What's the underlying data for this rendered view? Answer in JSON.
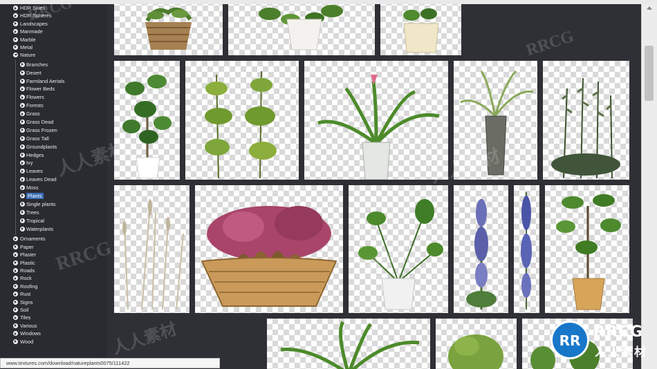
{
  "sidebar": {
    "categories_top": [
      "HDR Skies",
      "HDR Spheres",
      "Landscapes",
      "Manmade",
      "Marble",
      "Metal",
      "Nature"
    ],
    "nature_subcategories": [
      "Branches",
      "Desert",
      "Farmland Aerials",
      "Flower Beds",
      "Flowers",
      "Forests",
      "Grass",
      "Grass Dead",
      "Grass Frozen",
      "Grass Tall",
      "Groundplants",
      "Hedges",
      "Ivy",
      "Leaves",
      "Leaves Dead",
      "Moss",
      "Plants",
      "Single plants",
      "Trees",
      "Tropical",
      "Waterplants"
    ],
    "active_subcategory": "Plants",
    "categories_bottom": [
      "Ornaments",
      "Paper",
      "Plaster",
      "Plastic",
      "Roads",
      "Rock",
      "Roofing",
      "Rust",
      "Signs",
      "Soil",
      "Tiles",
      "Various",
      "Windows",
      "Wood"
    ]
  },
  "status": {
    "url": "www.textures.com/download/natureplants0075/111422"
  },
  "watermark": {
    "latin": "RRCG",
    "cjk": "人人素材"
  },
  "logo": {
    "mark": "RR",
    "text": "RRCG",
    "cjk": "人人素材"
  },
  "thumbnails": [
    {
      "subject": "potted plant in wicker basket"
    },
    {
      "subject": "leafy plant in white pot"
    },
    {
      "subject": "small plant in beige pot"
    },
    {
      "subject": "ficus plant in white pot"
    },
    {
      "subject": "two tall leafy shrubs"
    },
    {
      "subject": "bromeliad in ceramic pot"
    },
    {
      "subject": "spiky grass in tall grey planter"
    },
    {
      "subject": "rosemary shrub"
    },
    {
      "subject": "dry tall grass stalks"
    },
    {
      "subject": "heather in wooden basket"
    },
    {
      "subject": "philodendron in white pot"
    },
    {
      "subject": "tall blue flower spike"
    },
    {
      "subject": "narrow blue flower spike"
    },
    {
      "subject": "small tree in ceramic pot"
    },
    {
      "subject": "tall leafy plant"
    },
    {
      "subject": "round shrub"
    },
    {
      "subject": "green bushes"
    }
  ],
  "colors": {
    "sidebar_bg": "#2a2b31",
    "content_bg": "#2f3036",
    "active_highlight": "#3b6fb6",
    "logo_blue": "#1877c9"
  }
}
